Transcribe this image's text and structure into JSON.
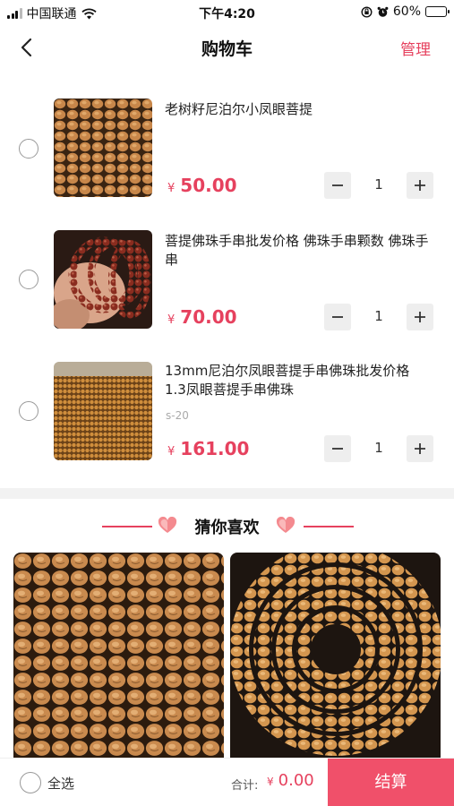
{
  "status_bar": {
    "carrier": "中国联通",
    "time": "下午4:20",
    "battery_percent": "60%",
    "battery_level": 0.6
  },
  "nav": {
    "title": "购物车",
    "manage": "管理"
  },
  "cart_items": [
    {
      "name": "老树籽尼泊尔小凤眼菩提",
      "spec": "",
      "currency": "¥",
      "price": "50.00",
      "quantity": "1"
    },
    {
      "name": "菩提佛珠手串批发价格 佛珠手串颗数 佛珠手串",
      "spec": "",
      "currency": "¥",
      "price": "70.00",
      "quantity": "1"
    },
    {
      "name": "13mm尼泊尔凤眼菩提手串佛珠批发价格 1.3凤眼菩提手串佛珠",
      "spec": "s-20",
      "currency": "¥",
      "price": "161.00",
      "quantity": "1"
    }
  ],
  "recommend": {
    "title": "猜你喜欢"
  },
  "bottom_bar": {
    "select_all": "全选",
    "total_label": "合计:",
    "currency": "¥",
    "total": "0.00",
    "checkout": "结算"
  },
  "colors": {
    "accent": "#e6415e",
    "checkout_bg": "#f0506a",
    "section_bg": "#f2f2f2"
  },
  "icons": [
    "signal-icon",
    "wifi-icon",
    "lock-rotation-icon",
    "alarm-icon",
    "battery-icon",
    "back-arrow-icon",
    "minus-icon",
    "plus-icon",
    "heart-icon"
  ]
}
